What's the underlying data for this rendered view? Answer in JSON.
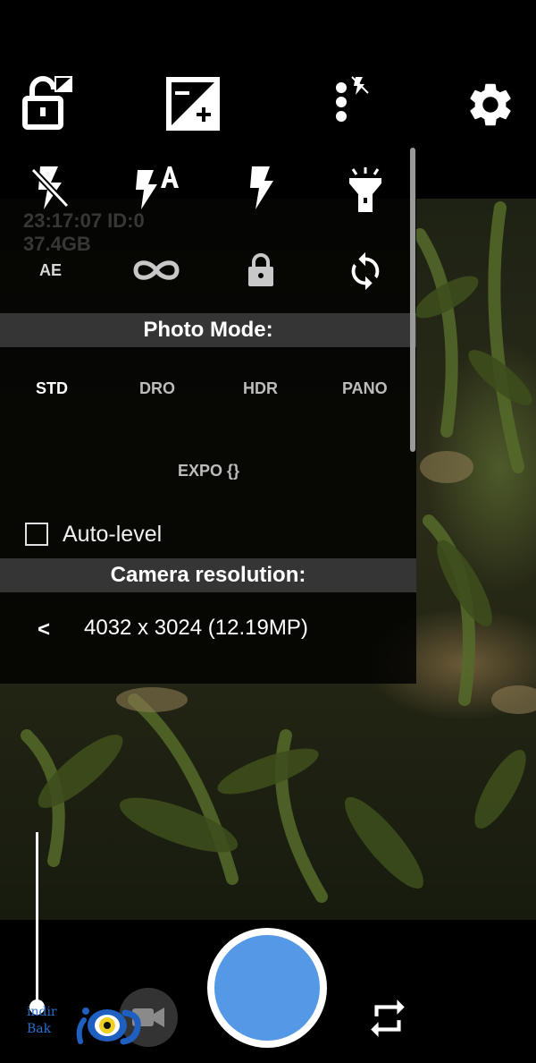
{
  "top_toolbar": {
    "icons": [
      "lock-rotation-icon",
      "exposure-plus-icon",
      "more-options-flash-off-icon",
      "settings-gear-icon"
    ]
  },
  "popup": {
    "flash_modes": [
      "flash-off-icon",
      "flash-auto-icon",
      "flash-on-icon",
      "torch-icon"
    ],
    "row2": {
      "ae_label": "AE",
      "icons": [
        "infinity-focus-icon",
        "lock-icon",
        "refresh-cycle-icon"
      ]
    },
    "overlay_info": {
      "line1": "23:17:07 ID:0",
      "line2": "37.4GB"
    },
    "photo_mode": {
      "header": "Photo Mode:",
      "modes": [
        "STD",
        "DRO",
        "HDR",
        "PANO"
      ],
      "selected": "STD",
      "extra_mode": "EXPO {}"
    },
    "auto_level": {
      "label": "Auto-level",
      "checked": false
    },
    "camera_resolution": {
      "header": "Camera resolution:",
      "prev_arrow": "<",
      "value": "4032 x 3024 (12.19MP)"
    }
  },
  "bottom_bar": {
    "shutter_color": "#5599e6",
    "icons": [
      "video-camera-icon",
      "switch-camera-icon"
    ]
  },
  "watermark": {
    "line1": "indir",
    "line2": "Bak"
  }
}
